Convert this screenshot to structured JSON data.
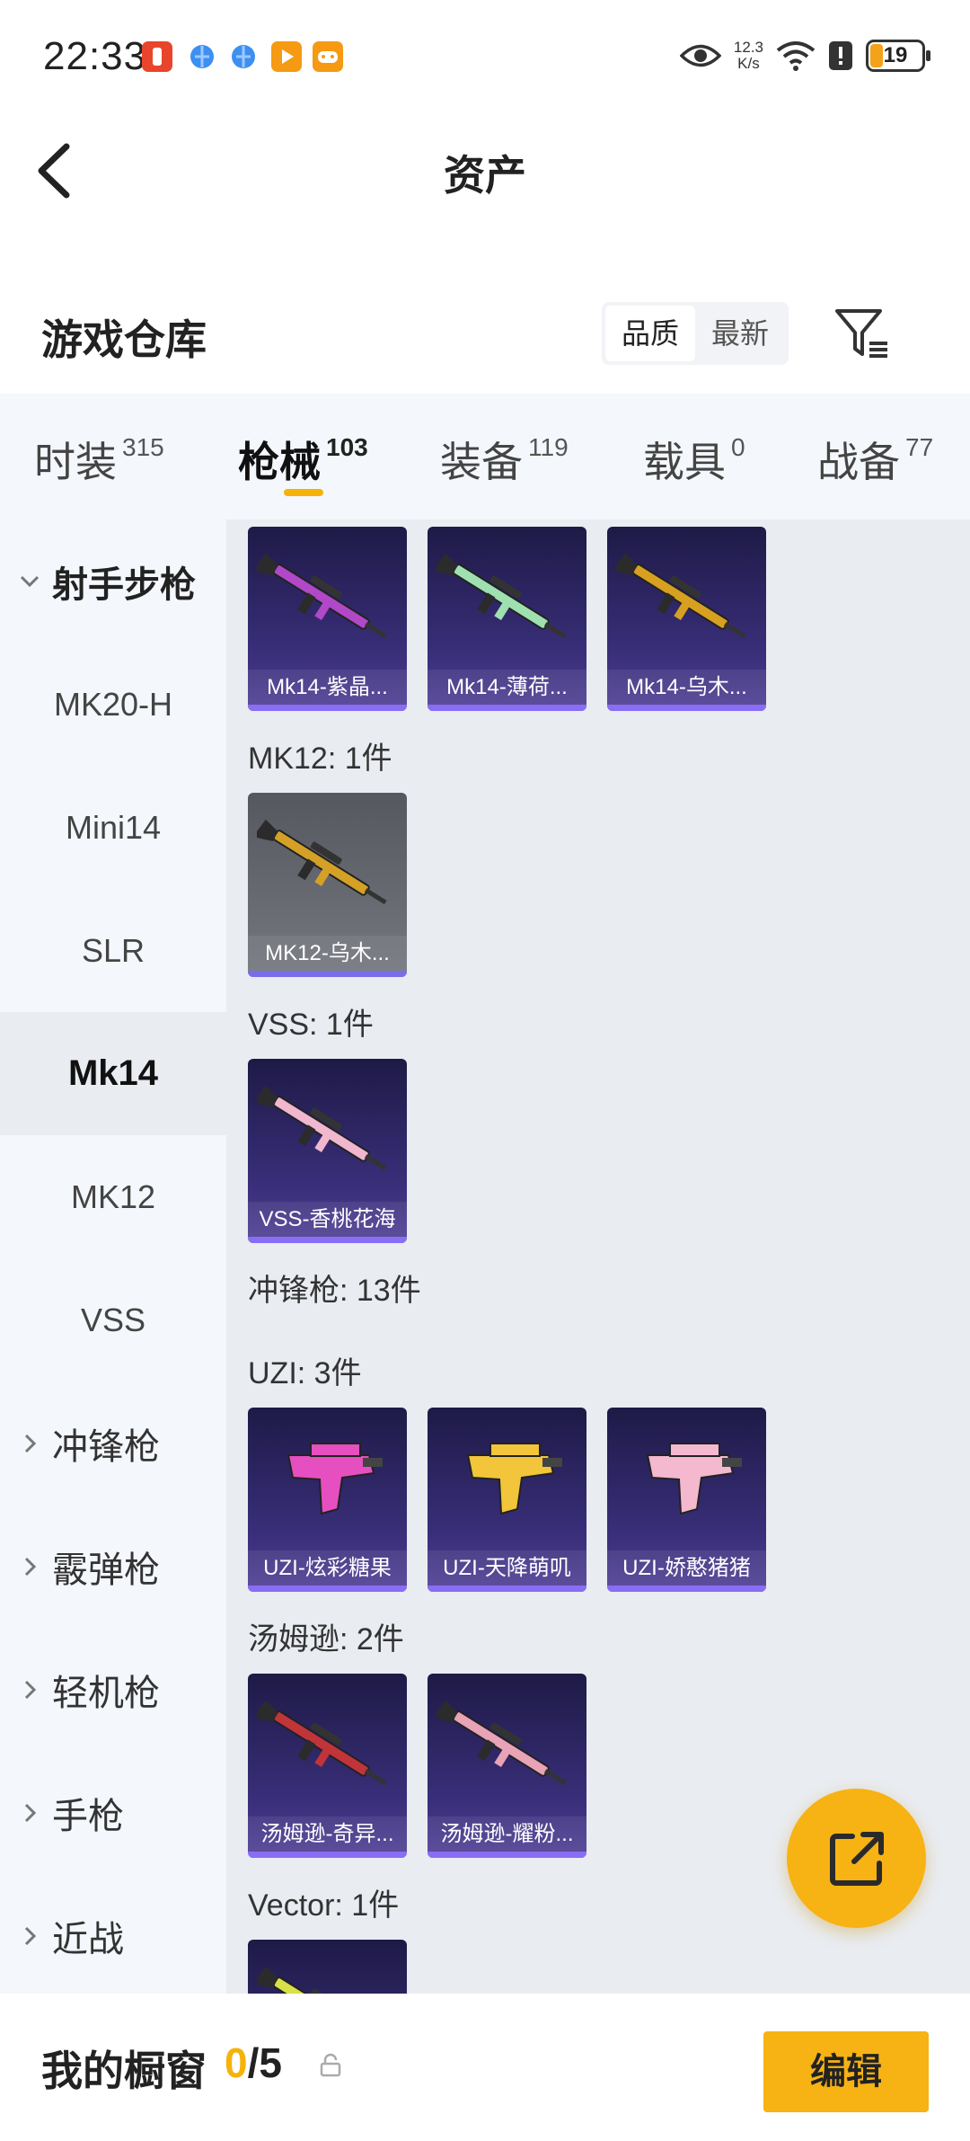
{
  "status_bar": {
    "time": "22:33",
    "net_speed_value": "12.3",
    "net_speed_unit": "K/s",
    "battery": "19",
    "notification_icons": [
      {
        "name": "app-notif-red-icon",
        "color": "#e8452c"
      },
      {
        "name": "browser-notif-icon-1",
        "color": "#3d8ff0"
      },
      {
        "name": "browser-notif-icon-2",
        "color": "#3d8ff0"
      },
      {
        "name": "video-notif-icon",
        "color": "#f59a12"
      },
      {
        "name": "game-notif-icon",
        "color": "#f59a12"
      }
    ]
  },
  "header": {
    "title": "资产"
  },
  "warehouse": {
    "title": "游戏仓库",
    "sort_options": [
      "品质",
      "最新"
    ],
    "active_sort": "品质"
  },
  "tabs": [
    {
      "label": "时装",
      "count": "315"
    },
    {
      "label": "枪械",
      "count": "103",
      "active": true
    },
    {
      "label": "装备",
      "count": "119"
    },
    {
      "label": "载具",
      "count": "0"
    },
    {
      "label": "战备",
      "count": "77"
    }
  ],
  "sidebar": {
    "items": [
      {
        "label": "射手步枪",
        "type": "group-open"
      },
      {
        "label": "MK20-H"
      },
      {
        "label": "Mini14"
      },
      {
        "label": "SLR"
      },
      {
        "label": "Mk14",
        "active": true
      },
      {
        "label": "MK12"
      },
      {
        "label": "VSS"
      },
      {
        "label": "冲锋枪",
        "type": "group"
      },
      {
        "label": "霰弹枪",
        "type": "group"
      },
      {
        "label": "轻机枪",
        "type": "group"
      },
      {
        "label": "手枪",
        "type": "group"
      },
      {
        "label": "近战",
        "type": "group"
      }
    ]
  },
  "content": {
    "sections": [
      {
        "title": "MK12: 1件"
      },
      {
        "title": "VSS: 1件"
      },
      {
        "title": "冲锋枪: 13件"
      },
      {
        "title": "UZI: 3件"
      },
      {
        "title": "汤姆逊: 2件"
      },
      {
        "title": "Vector: 1件"
      }
    ],
    "cards": [
      {
        "label": "Mk14-紫晶...",
        "gun_color": "#b048c8"
      },
      {
        "label": "Mk14-薄荷...",
        "gun_color": "#9fe0b0"
      },
      {
        "label": "Mk14-乌木...",
        "gun_color": "#d8a020"
      },
      {
        "label": "MK12-乌木...",
        "gun_color": "#d4a126"
      },
      {
        "label": "VSS-香桃花海",
        "gun_color": "#f0b7cf"
      },
      {
        "label": "UZI-炫彩糖果",
        "gun_color": "#e54fc0"
      },
      {
        "label": "UZI-天降萌叽",
        "gun_color": "#f2c53a"
      },
      {
        "label": "UZI-娇憨猪猪",
        "gun_color": "#f4b8cf"
      },
      {
        "label": "汤姆逊-奇异...",
        "gun_color": "#c0343a"
      },
      {
        "label": "汤姆逊-耀粉...",
        "gun_color": "#e8a3b6"
      },
      {
        "label": "",
        "gun_color": "#d8e04a"
      }
    ]
  },
  "bottom_bar": {
    "title": "我的橱窗",
    "current": "0",
    "separator_total": "/5",
    "edit_label": "编辑"
  },
  "colors": {
    "accent": "#f7b213",
    "card_purple": "#3a2f7b",
    "card_grey": "#6b6e75",
    "sidebar_bg": "#f4f7fb",
    "content_bg": "#e9ecf1"
  }
}
